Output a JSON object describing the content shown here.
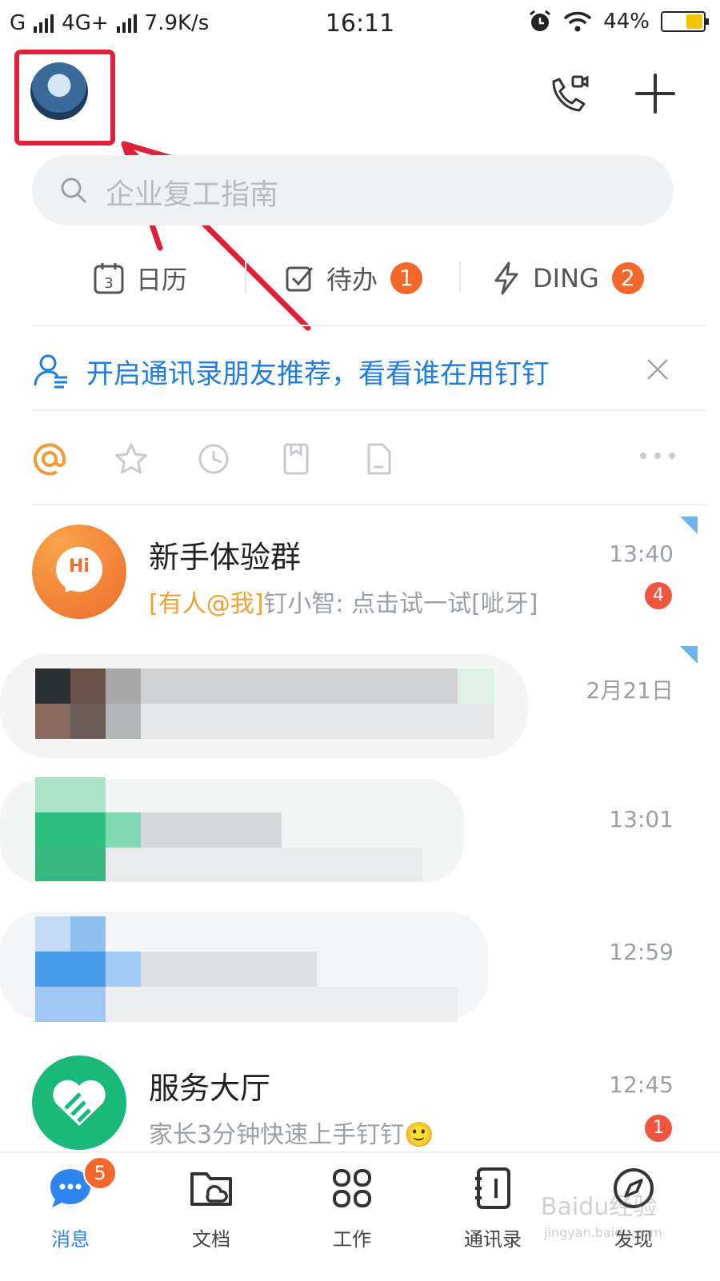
{
  "status_bar": {
    "left_text": "G",
    "network": "4G+",
    "speed": "7.9K/s",
    "time": "16:11",
    "battery": "44%"
  },
  "search": {
    "placeholder": "企业复工指南"
  },
  "quick_tabs": [
    {
      "label": "日历",
      "icon": "calendar-icon",
      "badge": ""
    },
    {
      "label": "待办",
      "icon": "checkbox-icon",
      "badge": "1"
    },
    {
      "label": "DING",
      "icon": "lightning-icon",
      "badge": "2"
    }
  ],
  "calendar_day": "3",
  "banner": {
    "text": "开启通讯录朋友推荐，看看谁在用钉钉"
  },
  "filters": [
    "at-icon",
    "star-icon",
    "clock-icon",
    "bookmark-icon",
    "file-icon",
    "more-icon"
  ],
  "conversations": [
    {
      "title": "新手体验群",
      "mention": "[有人@我]",
      "subtitle": "钉小智: 点击试一试[呲牙]",
      "time": "13:40",
      "badge": "4",
      "avatar_text": "Hi"
    },
    {
      "title": "",
      "subtitle": "",
      "time": "2月21日",
      "badge": ""
    },
    {
      "title": "",
      "subtitle": "",
      "time": "13:01",
      "badge": ""
    },
    {
      "title": "",
      "subtitle": "",
      "time": "12:59",
      "badge": ""
    },
    {
      "title": "服务大厅",
      "subtitle": "家长3分钟快速上手钉钉🙂",
      "time": "12:45",
      "badge": "1"
    }
  ],
  "bottom_nav": [
    {
      "label": "消息",
      "icon": "chat-icon",
      "badge": "5",
      "active": true
    },
    {
      "label": "文档",
      "icon": "folder-icon",
      "badge": "",
      "active": false
    },
    {
      "label": "工作",
      "icon": "grid-icon",
      "badge": "",
      "active": false
    },
    {
      "label": "通讯录",
      "icon": "contacts-icon",
      "badge": "",
      "active": false
    },
    {
      "label": "发现",
      "icon": "compass-icon",
      "badge": "",
      "active": false
    }
  ],
  "watermark": {
    "text": "Baidu经验",
    "sub": "jingyan.baidu.com"
  },
  "colors": {
    "accent": "#1f7de0",
    "badge": "#f4672a",
    "annotation": "#e0203a"
  }
}
